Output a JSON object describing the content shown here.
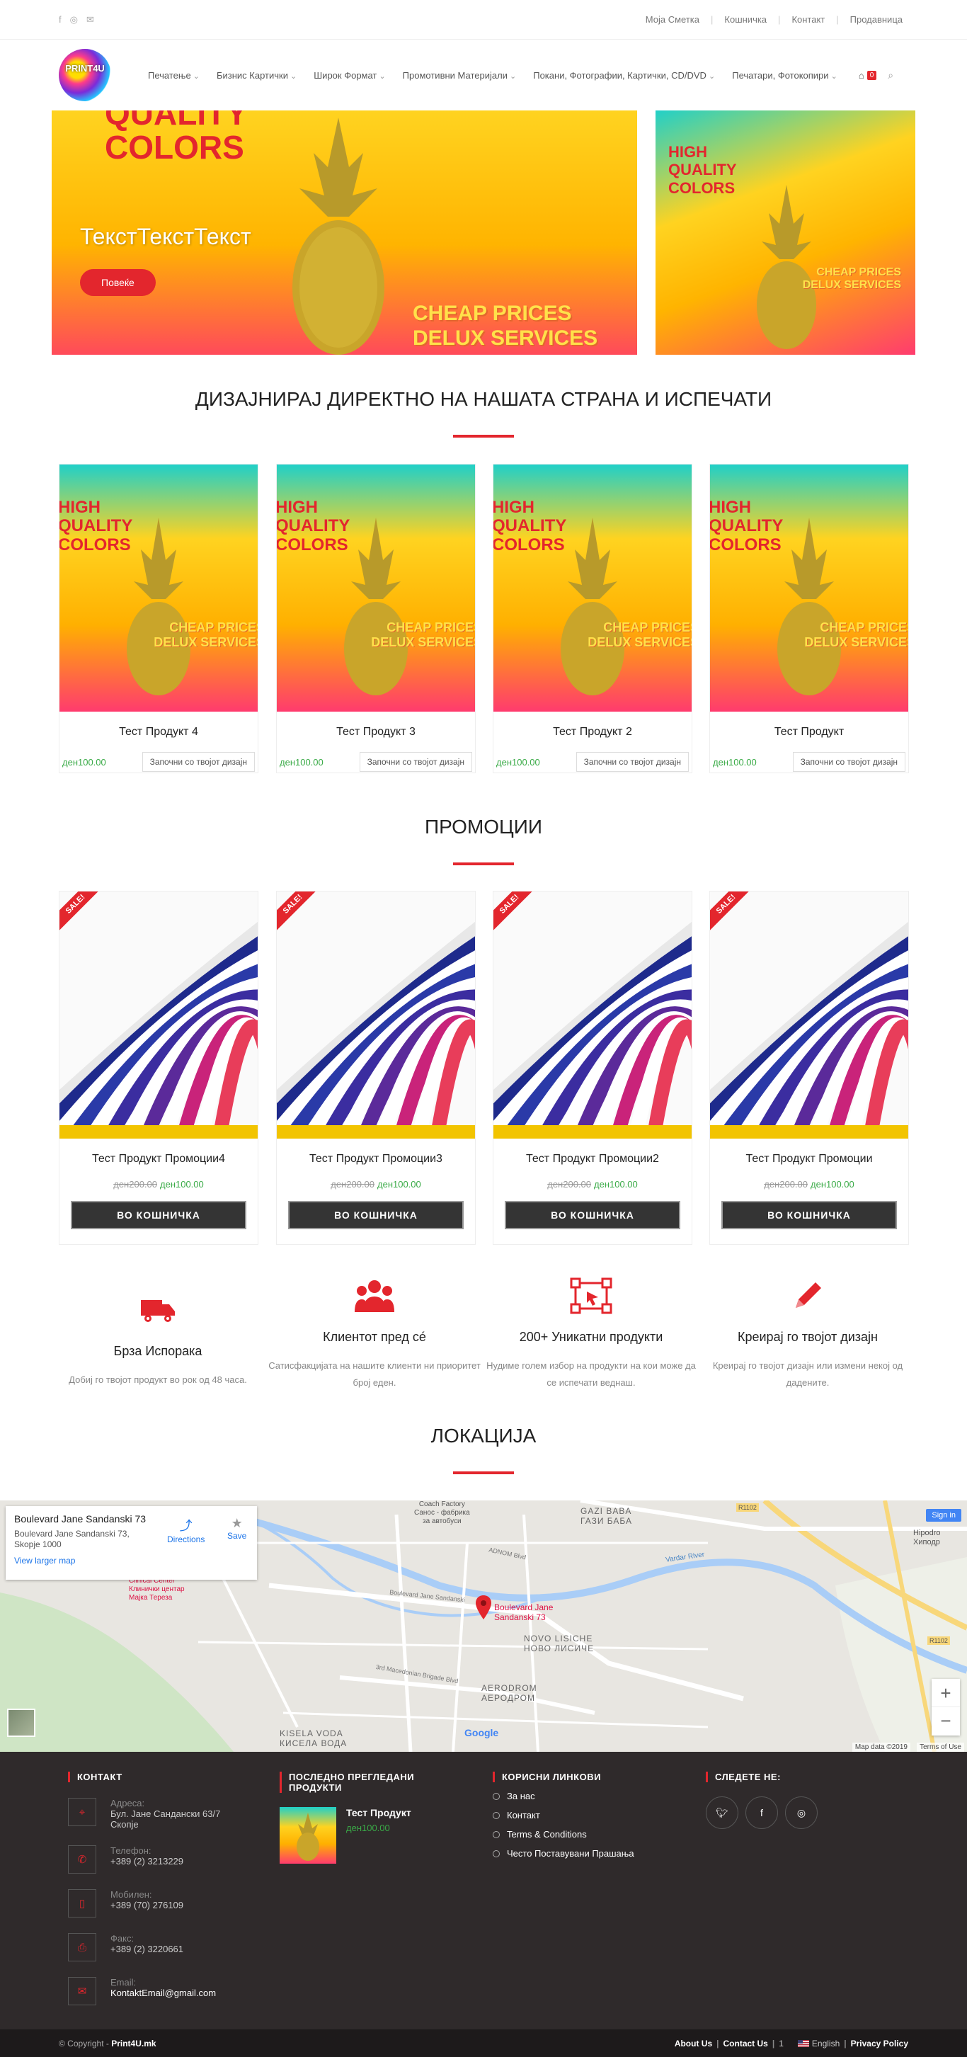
{
  "topbar": {
    "social": [
      "facebook-icon",
      "instagram-icon",
      "email-icon"
    ],
    "links": [
      "Моја Сметка",
      "Кошничка",
      "Контакт",
      "Продавница"
    ]
  },
  "logo": {
    "text": "PRINT4U"
  },
  "nav": [
    "Печатење",
    "Бизнис Картички",
    "Широк Формат",
    "Промотивни Материјали",
    "Покани, Фотографии, Картички, CD/DVD",
    "Печатари, Фотокопири"
  ],
  "cart": {
    "count": "0"
  },
  "hero": {
    "art_line1": "QUALITY",
    "art_line2": "COLORS",
    "title": "ТекстТекстТекст",
    "button": "Повеќе",
    "tag1": "CHEAP PRICES",
    "tag2": "DELUX SERVICES"
  },
  "side": {
    "q1": "HIGH",
    "q2": "QUALITY",
    "q3": "COLORS",
    "t1": "CHEAP PRICES",
    "t2": "DELUX SERVICES"
  },
  "design_section": {
    "title": "ДИЗАЈНИРАЈ ДИРЕКТНО НА НАШАТА СТРАНА И ИСПЕЧАТИ",
    "art": {
      "q1": "HIGH",
      "q2": "QUALITY",
      "q3": "COLORS",
      "t1": "CHEAP PRICES",
      "t2": "DELUX SERVICES"
    },
    "products": [
      {
        "name": "Тест Продукт 4",
        "price": "ден100.00",
        "button": "Започни со твојот дизајн"
      },
      {
        "name": "Тест Продукт 3",
        "price": "ден100.00",
        "button": "Започни со твојот дизајн"
      },
      {
        "name": "Тест Продукт 2",
        "price": "ден100.00",
        "button": "Започни со твојот дизајн"
      },
      {
        "name": "Тест Продукт",
        "price": "ден100.00",
        "button": "Започни со твојот дизајн"
      }
    ]
  },
  "promo_section": {
    "title": "ПРОМОЦИИ",
    "sale": "SALE!",
    "products": [
      {
        "name": "Тест Продукт Промоции4",
        "old": "ден200.00",
        "new": "ден100.00",
        "button": "ВО КОШНИЧКА"
      },
      {
        "name": "Тест Продукт Промоции3",
        "old": "ден200.00",
        "new": "ден100.00",
        "button": "ВО КОШНИЧКА"
      },
      {
        "name": "Тест Продукт Промоции2",
        "old": "ден200.00",
        "new": "ден100.00",
        "button": "ВО КОШНИЧКА"
      },
      {
        "name": "Тест Продукт Промоции",
        "old": "ден200.00",
        "new": "ден100.00",
        "button": "ВО КОШНИЧКА"
      }
    ]
  },
  "features": [
    {
      "icon": "truck-icon",
      "title": "Брза Испорака",
      "text": "Добиј го твојот продукт во рок од 48 часа."
    },
    {
      "icon": "users-icon",
      "title": "Клиентот пред сé",
      "text": "Сатисфакцијата на нашите клиенти ни приоритет број еден."
    },
    {
      "icon": "vector-icon",
      "title": "200+ Уникатни продукти",
      "text": "Нудиме голем избор на продукти на кои може да се испечати веднаш."
    },
    {
      "icon": "pencil-icon",
      "title": "Креирај го твојот дизајн",
      "text": "Креирај го твојот дизајн или измени некој од дадените."
    }
  ],
  "location": {
    "title": "ЛОКАЦИЈА",
    "card_title": "Boulevard Jane Sandanski 73",
    "card_addr1": "Boulevard Jane Sandanski 73,",
    "card_addr2": "Skopje 1000",
    "directions": "Directions",
    "save": "Save",
    "larger": "View larger map",
    "sign_in": "Sign in",
    "pin_label1": "Boulevard Jane",
    "pin_label2": "Sandanski 73",
    "labels": {
      "gazi_baba": "GAZI BABA",
      "gazi_baba_cyr": "ГАЗИ БАБА",
      "novo": "NOVO LISICHE",
      "novo_cyr": "НОВО ЛИСИЧЕ",
      "aerodrom": "AERODROM",
      "aerodrom_cyr": "АЕРОДРОМ",
      "kisela": "KISELA VODA",
      "kisela_cyr": "КИСЕЛА ВОДА",
      "clinical": "Clinical Center",
      "clinical2": "Клинички центар",
      "clinical3": "Мајка Тереза",
      "coach": "Coach Factory",
      "coach2": "Санос - фабрика",
      "coach3": "за автобуси",
      "vardar": "Vardar River",
      "hipodrom": "Hipodro",
      "hipodrom2": "Хиподр",
      "adnom": "ADNOM Blvd",
      "blvd1": "Boulevard Jane Sandanski",
      "blvd2": "3rd Macedonian Brigade Blvd",
      "r1102": "R1102",
      "r1102b": "R1102"
    },
    "map_footer": "Map data ©2019",
    "terms": "Terms of Use",
    "google": "Google"
  },
  "footer": {
    "contact_head": "КОНТАКТ",
    "contacts": [
      {
        "icon": "map-pin-icon",
        "label": "Адреса:",
        "value": "Бул. Јане Сандански 63/7",
        "value2": "Скопје"
      },
      {
        "icon": "phone-icon",
        "label": "Телефон:",
        "value": "+389 (2) 3213229"
      },
      {
        "icon": "mobile-icon",
        "label": "Мобилен:",
        "value": "+389 (70) 276109"
      },
      {
        "icon": "fax-icon",
        "label": "Факс:",
        "value": "+389 (2) 3220661"
      },
      {
        "icon": "mail-icon",
        "label": "Email:",
        "value": "KontaktEmail@gmail.com"
      }
    ],
    "recent_head": "ПОСЛЕДНО ПРЕГЛЕДАНИ ПРОДУКТИ",
    "recent_name": "Тест Продукт",
    "recent_price": "ден100.00",
    "links_head": "КОРИСНИ ЛИНКОВИ",
    "links": [
      "За нас",
      "Контакт",
      "Terms & Conditions",
      "Често Поставувани Прашања"
    ],
    "follow_head": "СЛЕДЕТЕ НЕ:",
    "social": [
      "twitter-icon",
      "facebook-icon",
      "instagram-icon"
    ]
  },
  "bottom": {
    "copyright": "© Copyright - ",
    "brand": "Print4U.mk",
    "links": [
      "About Us",
      "Contact Us"
    ],
    "one": "1",
    "lang": "English",
    "privacy": "Privacy Policy"
  }
}
